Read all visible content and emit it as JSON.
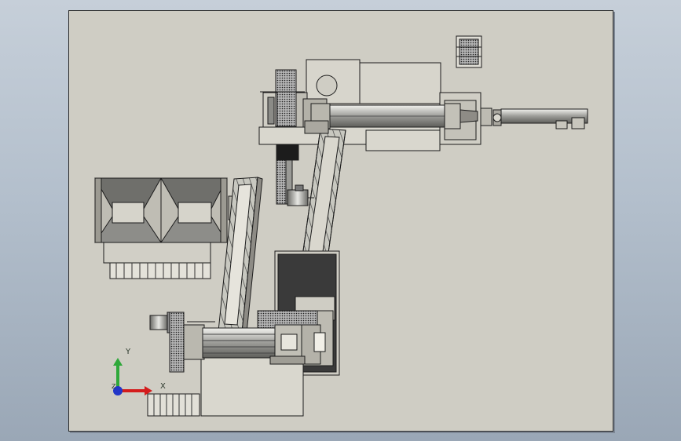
{
  "viewport": {
    "background": "gradient-blue-grey"
  },
  "drawing": {
    "sheet_color": "#cfcdc4",
    "line_color": "#1c1c1c"
  },
  "triad": {
    "x_label": "X",
    "y_label": "Y",
    "z_label": "Z",
    "x_color": "#d41c1c",
    "y_color": "#2fa83a",
    "z_color": "#2236c8"
  }
}
